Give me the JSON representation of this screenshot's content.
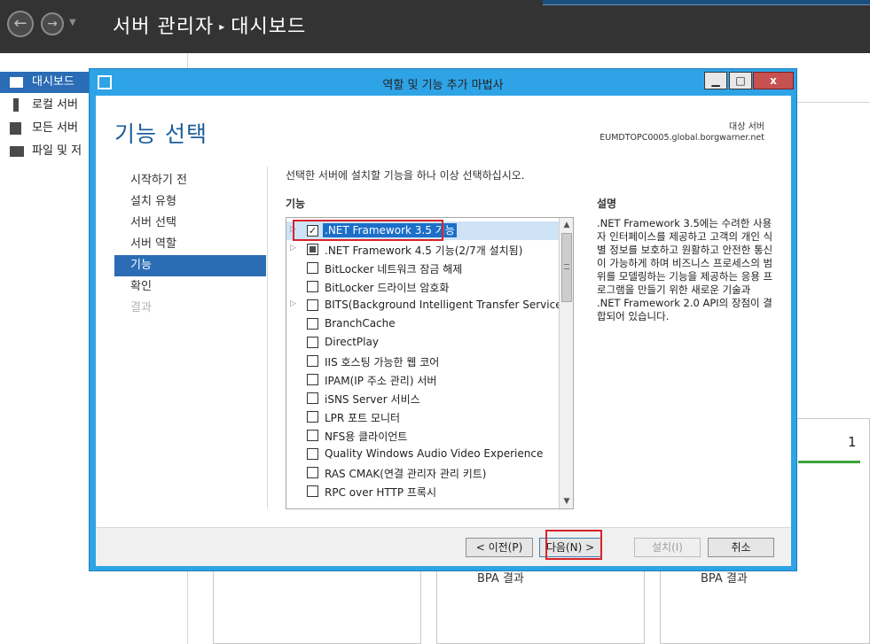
{
  "server_manager": {
    "title": "서버 관리자",
    "breadcrumb_sep": "▸",
    "page": "대시보드",
    "sidebar": [
      {
        "label": "대시보드",
        "active": true
      },
      {
        "label": "로컬 서버",
        "active": false
      },
      {
        "label": "모든 서버",
        "active": false
      },
      {
        "label": "파일 및 저",
        "active": false
      }
    ],
    "tile_count": "1",
    "tile_bpa": [
      "BPA 결과",
      "BPA 결과"
    ]
  },
  "wizard": {
    "title": "역할 및 기능 추가 마법사",
    "heading": "기능 선택",
    "destination_label": "대상 서버",
    "destination_server": "EUMDTOPC0005.global.borgwarner.net",
    "steps": [
      {
        "label": "시작하기 전",
        "state": "normal"
      },
      {
        "label": "설치 유형",
        "state": "normal"
      },
      {
        "label": "서버 선택",
        "state": "normal"
      },
      {
        "label": "서버 역할",
        "state": "normal"
      },
      {
        "label": "기능",
        "state": "active"
      },
      {
        "label": "확인",
        "state": "normal"
      },
      {
        "label": "결과",
        "state": "disabled"
      }
    ],
    "instruction": "선택한 서버에 설치할 기능을 하나 이상 선택하십시오.",
    "features_label": "기능",
    "description_label": "설명",
    "features": [
      {
        "label": ".NET Framework 3.5 기능",
        "expandable": true,
        "check": "checked",
        "selected": true
      },
      {
        "label": ".NET Framework 4.5 기능(2/7개 설치됨)",
        "expandable": true,
        "check": "partial",
        "selected": false
      },
      {
        "label": "BitLocker 네트워크 잠금 해제",
        "expandable": false,
        "check": "unchecked",
        "selected": false
      },
      {
        "label": "BitLocker 드라이브 암호화",
        "expandable": false,
        "check": "unchecked",
        "selected": false
      },
      {
        "label": "BITS(Background Intelligent Transfer Service)",
        "expandable": true,
        "check": "unchecked",
        "selected": false
      },
      {
        "label": "BranchCache",
        "expandable": false,
        "check": "unchecked",
        "selected": false
      },
      {
        "label": "DirectPlay",
        "expandable": false,
        "check": "unchecked",
        "selected": false
      },
      {
        "label": "IIS 호스팅 가능한 웹 코어",
        "expandable": false,
        "check": "unchecked",
        "selected": false
      },
      {
        "label": "IPAM(IP 주소 관리) 서버",
        "expandable": false,
        "check": "unchecked",
        "selected": false
      },
      {
        "label": "iSNS Server 서비스",
        "expandable": false,
        "check": "unchecked",
        "selected": false
      },
      {
        "label": "LPR 포트 모니터",
        "expandable": false,
        "check": "unchecked",
        "selected": false
      },
      {
        "label": "NFS용 클라이언트",
        "expandable": false,
        "check": "unchecked",
        "selected": false
      },
      {
        "label": "Quality Windows Audio Video Experience",
        "expandable": false,
        "check": "unchecked",
        "selected": false
      },
      {
        "label": "RAS CMAK(연결 관리자 관리 키트)",
        "expandable": false,
        "check": "unchecked",
        "selected": false
      },
      {
        "label": "RPC over HTTP 프록시",
        "expandable": false,
        "check": "unchecked",
        "selected": false
      }
    ],
    "description": ".NET Framework 3.5에는 수려한 사용자 인터페이스를 제공하고 고객의 개인 식별 정보를 보호하고 원활하고 안전한 통신이 가능하게 하며 비즈니스 프로세스의 범위를 모델링하는 기능을 제공하는 응용 프로그램을 만들기 위한 새로운 기술과 .NET Framework 2.0 API의 장점이 결합되어 있습니다.",
    "buttons": {
      "prev": "< 이전(P)",
      "next": "다음(N) >",
      "install": "설치(I)",
      "cancel": "취소"
    },
    "window_buttons": {
      "minimize": "▁",
      "maximize": "□",
      "close": "x"
    }
  }
}
